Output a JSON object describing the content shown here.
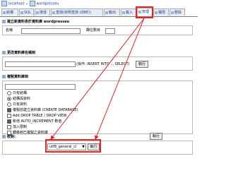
{
  "breadcrumb": {
    "server": "localhost",
    "separator": "»",
    "database": "wordpresseu"
  },
  "tabs": [
    {
      "label": "結構",
      "active": false
    },
    {
      "label": "SQL",
      "active": false
    },
    {
      "label": "搜尋",
      "active": false
    },
    {
      "label": "查詢(依例查詢 (QBE))",
      "active": false
    },
    {
      "label": "輸出",
      "active": false
    },
    {
      "label": "載入",
      "active": false
    },
    {
      "label": "管理",
      "active": true
    },
    {
      "label": "權限",
      "active": false
    },
    {
      "label": "刪除",
      "active": false
    }
  ],
  "create_table": {
    "title": "建立新資料表於資料庫 wordpresseu",
    "name_label": "名稱",
    "fields_label": "欄位數目"
  },
  "rename": {
    "title": "更改資料庫名稱到",
    "hint": "(操作: INSERT INTO ... SELECT)",
    "button": "執行"
  },
  "copy": {
    "title": "複製資料庫到",
    "options": [
      {
        "label": "只有結構",
        "type": "radio",
        "checked": false
      },
      {
        "label": "結構與資料",
        "type": "radio",
        "checked": true
      },
      {
        "label": "只有資料",
        "type": "radio",
        "checked": false
      },
      {
        "label": "複製前建立資料庫 (CREATE DATABASE)",
        "type": "checkbox",
        "checked": true
      },
      {
        "label": "Add DROP TABLE / DROP VIEW",
        "type": "checkbox",
        "checked": false
      },
      {
        "label": "新增 AUTO_INCREMENT 數值",
        "type": "checkbox",
        "checked": true
      },
      {
        "label": "加入限制",
        "type": "checkbox",
        "checked": false
      },
      {
        "label": "轉移到已複製之資料庫",
        "type": "checkbox",
        "checked": false
      }
    ],
    "button": "執行"
  },
  "collation": {
    "title": "校對:",
    "selected": "utf8_general_ci",
    "button": "執行"
  },
  "colors": {
    "highlight": "#e22222",
    "link": "#0b3cad"
  }
}
